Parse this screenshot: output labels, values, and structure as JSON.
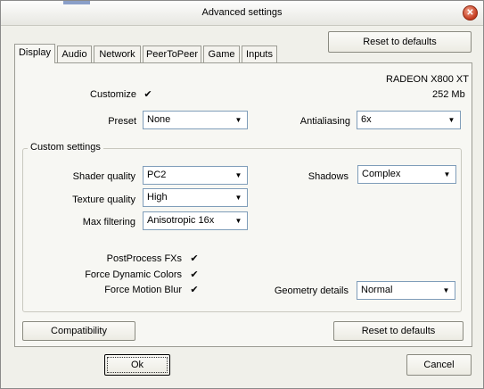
{
  "window": {
    "title": "Advanced settings"
  },
  "buttons": {
    "reset_top": "Reset to defaults",
    "reset_bottom": "Reset to defaults",
    "compatibility": "Compatibility",
    "ok": "Ok",
    "cancel": "Cancel"
  },
  "tabs": [
    "Display",
    "Audio",
    "Network",
    "PeerToPeer",
    "Game",
    "Inputs"
  ],
  "gpu": {
    "name": "RADEON X800 XT",
    "memory": "252 Mb"
  },
  "display": {
    "customize_label": "Customize",
    "customize_checked": true,
    "preset_label": "Preset",
    "preset_value": "None",
    "antialiasing_label": "Antialiasing",
    "antialiasing_value": "6x"
  },
  "custom": {
    "group_title": "Custom settings",
    "shader_label": "Shader quality",
    "shader_value": "PC2",
    "texture_label": "Texture quality",
    "texture_value": "High",
    "filtering_label": "Max filtering",
    "filtering_value": "Anisotropic 16x",
    "shadows_label": "Shadows",
    "shadows_value": "Complex",
    "postprocess_label": "PostProcess FXs",
    "dynamic_colors_label": "Force Dynamic Colors",
    "motion_blur_label": "Force Motion Blur",
    "geometry_label": "Geometry details",
    "geometry_value": "Normal"
  }
}
